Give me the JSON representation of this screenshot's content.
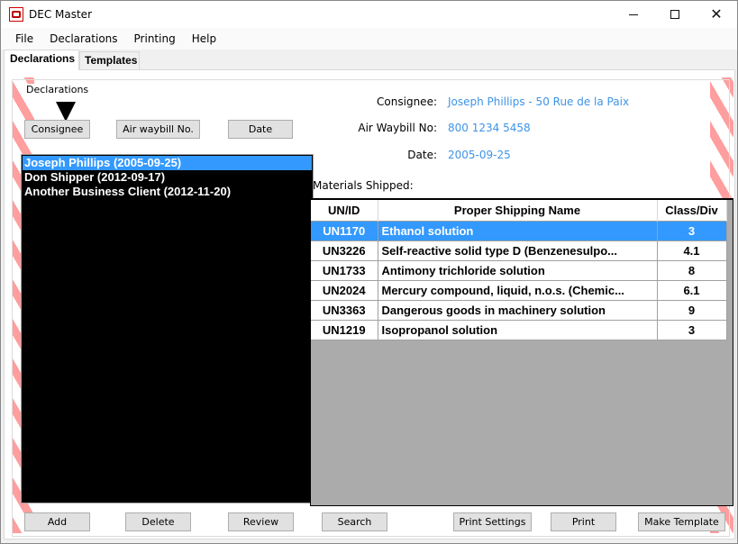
{
  "window": {
    "title": "DEC Master",
    "controls": {
      "minimize": "minimize",
      "maximize": "maximize",
      "close": "close"
    }
  },
  "menubar": [
    "File",
    "Declarations",
    "Printing",
    "Help"
  ],
  "tabs": [
    {
      "label": "Declarations",
      "active": true
    },
    {
      "label": "Templates",
      "active": false
    }
  ],
  "group": {
    "label": "Declarations"
  },
  "sort_buttons": {
    "consignee": "Consignee",
    "airwaybill": "Air waybill No.",
    "date": "Date",
    "active_sort": "Consignee"
  },
  "declarations": [
    {
      "label": "Joseph Phillips (2005-09-25)",
      "selected": true
    },
    {
      "label": "Don Shipper (2012-09-17)",
      "selected": false
    },
    {
      "label": "Another Business Client (2012-11-20)",
      "selected": false
    }
  ],
  "details": {
    "consignee_label": "Consignee:",
    "consignee_value": "Joseph Phillips - 50 Rue de la Paix",
    "airwaybill_label": "Air Waybill No:",
    "airwaybill_value": "800 1234 5458",
    "date_label": "Date:",
    "date_value": "2005-09-25",
    "materials_label": "Materials Shipped:"
  },
  "materials": {
    "columns": [
      "UN/ID",
      "Proper Shipping Name",
      "Class/Div"
    ],
    "rows": [
      {
        "id": "UN1170",
        "name": "Ethanol solution",
        "class": "3",
        "selected": true
      },
      {
        "id": "UN3226",
        "name": "Self-reactive solid type D  (Benzenesulpo...",
        "class": "4.1",
        "selected": false
      },
      {
        "id": "UN1733",
        "name": "Antimony trichloride solution",
        "class": "8",
        "selected": false
      },
      {
        "id": "UN2024",
        "name": "Mercury compound, liquid, n.o.s. (Chemic...",
        "class": "6.1",
        "selected": false
      },
      {
        "id": "UN3363",
        "name": "Dangerous goods in machinery solution",
        "class": "9",
        "selected": false
      },
      {
        "id": "UN1219",
        "name": "Isopropanol solution",
        "class": "3",
        "selected": false
      }
    ]
  },
  "actions": {
    "add": "Add",
    "delete": "Delete",
    "review": "Review",
    "search": "Search",
    "print_settings": "Print Settings",
    "print": "Print",
    "make_template": "Make Template"
  },
  "colors": {
    "accent_selection": "#3399ff",
    "value_text": "#3e94e6",
    "hazard_stripe": "#ff9e9e",
    "list_background": "#000000",
    "grid_empty": "#ababab"
  }
}
